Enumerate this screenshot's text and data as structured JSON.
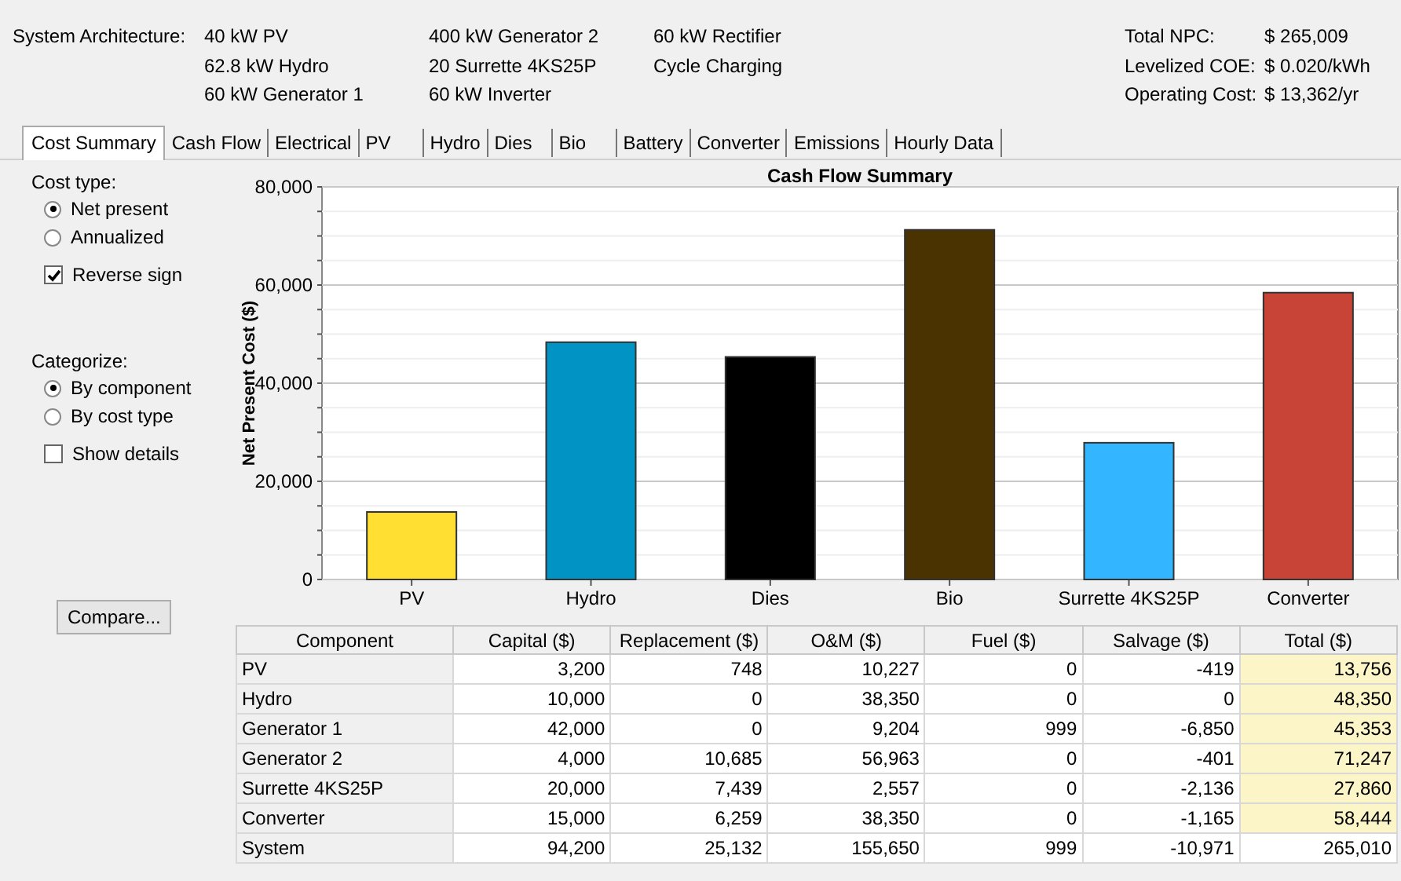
{
  "architecture": {
    "label": "System Architecture:",
    "columns": [
      [
        "40 kW PV",
        "62.8 kW Hydro",
        "60 kW Generator 1"
      ],
      [
        "400 kW Generator 2",
        "20 Surrette 4KS25P",
        "60 kW Inverter"
      ],
      [
        "60 kW Rectifier",
        "Cycle Charging"
      ]
    ]
  },
  "summary": [
    {
      "label": "Total NPC:",
      "value": "$ 265,009"
    },
    {
      "label": "Levelized COE:",
      "value": "$ 0.020/kWh"
    },
    {
      "label": "Operating Cost:",
      "value": "$ 13,362/yr"
    }
  ],
  "tabs": [
    {
      "label": "Cost Summary",
      "selected": true
    },
    {
      "label": "Cash Flow",
      "selected": false
    },
    {
      "label": "Electrical",
      "selected": false
    },
    {
      "label": "PV",
      "selected": false
    },
    {
      "label": "Hydro",
      "selected": false
    },
    {
      "label": "Dies",
      "selected": false
    },
    {
      "label": "Bio",
      "selected": false
    },
    {
      "label": "Battery",
      "selected": false
    },
    {
      "label": "Converter",
      "selected": false
    },
    {
      "label": "Emissions",
      "selected": false
    },
    {
      "label": "Hourly Data",
      "selected": false
    }
  ],
  "cost_type": {
    "label": "Cost type:",
    "options": [
      {
        "label": "Net present",
        "selected": true
      },
      {
        "label": "Annualized",
        "selected": false
      }
    ]
  },
  "reverse_sign": {
    "label": "Reverse sign",
    "checked": true
  },
  "categorize": {
    "label": "Categorize:",
    "options": [
      {
        "label": "By component",
        "selected": true
      },
      {
        "label": "By cost type",
        "selected": false
      }
    ]
  },
  "show_details": {
    "label": "Show details",
    "checked": false
  },
  "compare_button": "Compare...",
  "chart": {
    "chart_data": {
      "type": "bar",
      "title": "Cash Flow Summary",
      "ylabel": "Net Present Cost ($)",
      "categories": [
        "PV",
        "Hydro",
        "Dies",
        "Bio",
        "Surrette 4KS25P",
        "Converter"
      ],
      "values": [
        13756,
        48350,
        45353,
        71247,
        27860,
        58444
      ],
      "grid": true,
      "colors": [
        "#ffdf32",
        "#0093c4",
        "#000000",
        "#4a3300",
        "#33b5ff",
        "#c84436"
      ],
      "ylim": [
        0,
        80000
      ],
      "yticks": [
        {
          "value": 0,
          "label": "0"
        },
        {
          "value": 20000,
          "label": "20,000"
        },
        {
          "value": 40000,
          "label": "40,000"
        },
        {
          "value": 60000,
          "label": "60,000"
        },
        {
          "value": 80000,
          "label": "80,000"
        }
      ]
    }
  },
  "table": {
    "columns": [
      "Component",
      "Capital ($)",
      "Replacement ($)",
      "O&M ($)",
      "Fuel ($)",
      "Salvage ($)",
      "Total ($)"
    ],
    "rows": [
      [
        "PV",
        "3,200",
        "748",
        "10,227",
        "0",
        "-419",
        "13,756"
      ],
      [
        "Hydro",
        "10,000",
        "0",
        "38,350",
        "0",
        "0",
        "48,350"
      ],
      [
        "Generator 1",
        "42,000",
        "0",
        "9,204",
        "999",
        "-6,850",
        "45,353"
      ],
      [
        "Generator 2",
        "4,000",
        "10,685",
        "56,963",
        "0",
        "-401",
        "71,247"
      ],
      [
        "Surrette 4KS25P",
        "20,000",
        "7,439",
        "2,557",
        "0",
        "-2,136",
        "27,860"
      ],
      [
        "Converter",
        "15,000",
        "6,259",
        "38,350",
        "0",
        "-1,165",
        "58,444"
      ],
      [
        "System",
        "94,200",
        "25,132",
        "155,650",
        "999",
        "-10,971",
        "265,010"
      ]
    ]
  }
}
